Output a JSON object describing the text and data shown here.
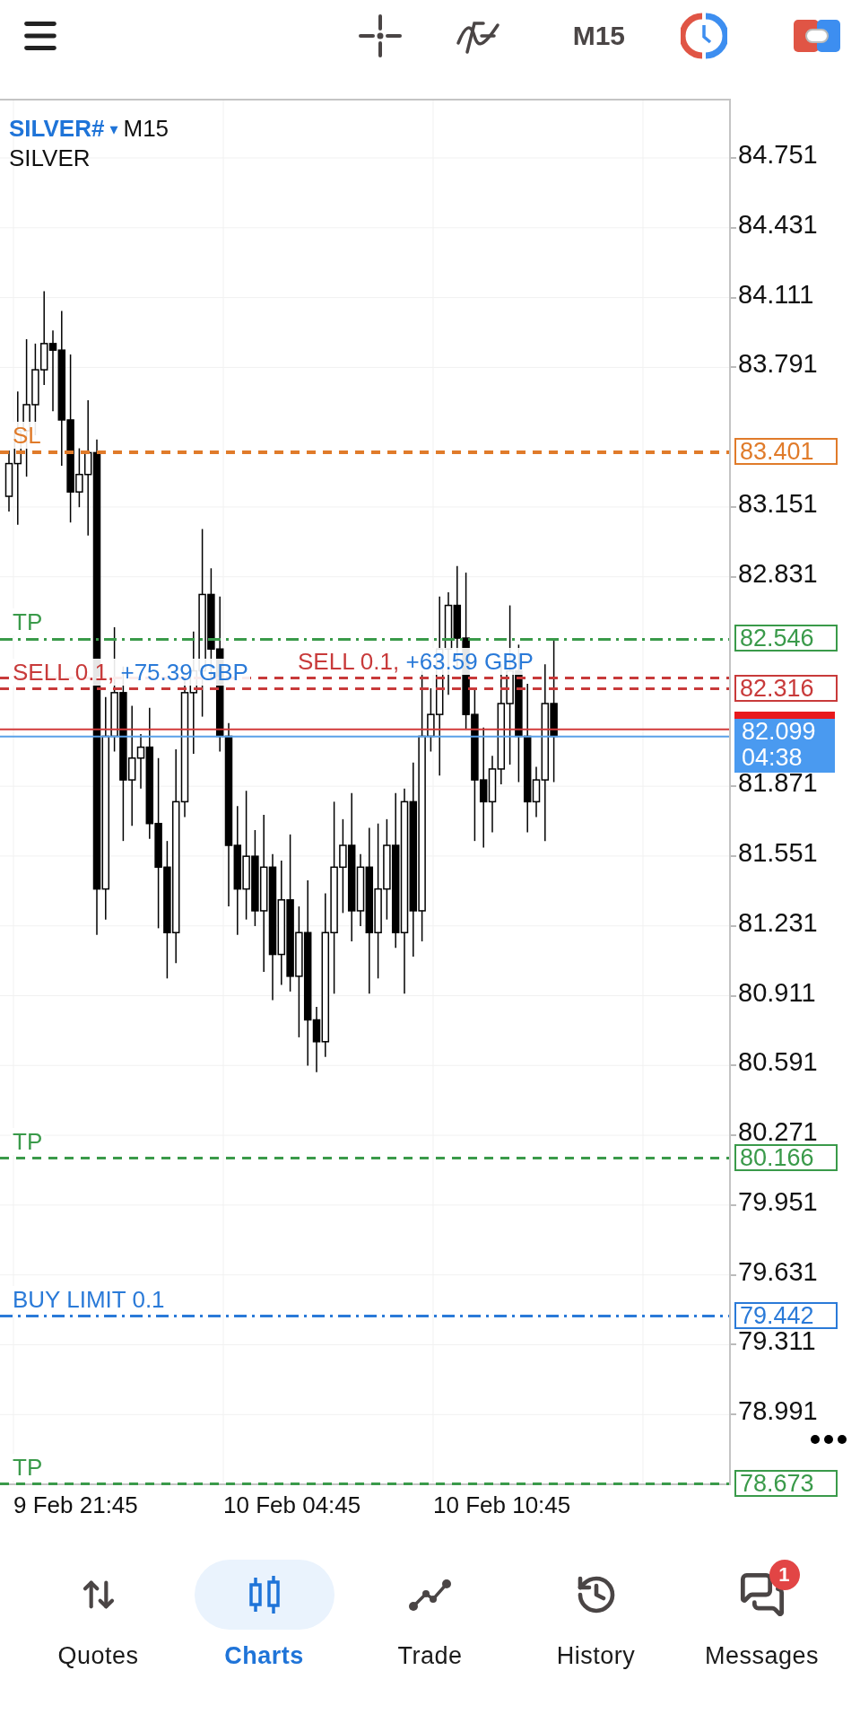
{
  "toolbar": {
    "timeframe": "M15"
  },
  "chart": {
    "symbol": "SILVER#",
    "caret": "▾",
    "timeframe": "M15",
    "description": "SILVER",
    "price_ticks": [
      "84.751",
      "84.431",
      "84.111",
      "83.791",
      "83.151",
      "82.831",
      "81.871",
      "81.551",
      "81.231",
      "80.911",
      "80.591",
      "80.271",
      "79.951",
      "79.631",
      "79.311",
      "78.991"
    ],
    "lines": [
      {
        "kind": "sl",
        "label": "SL",
        "price": "83.401",
        "dash_dot": false
      },
      {
        "kind": "tp",
        "label": "TP",
        "price": "82.546",
        "dash_dot": true
      },
      {
        "kind": "sell",
        "label": "SELL 0.1,",
        "profit": "+75.39 GBP",
        "price": "82.316",
        "dash_dot": false
      },
      {
        "kind": "sell",
        "label": "SELL 0.1,",
        "profit": "+63.59 GBP",
        "dash_dot": false
      },
      {
        "kind": "tp",
        "label": "TP",
        "price": "80.166",
        "dash_dot": false
      },
      {
        "kind": "buy_limit",
        "label": "BUY LIMIT 0.1",
        "price": "79.442",
        "dash_dot": true
      },
      {
        "kind": "tp",
        "label": "TP",
        "price": "78.673",
        "dash_dot": false
      }
    ],
    "current": {
      "price": "82.099",
      "countdown": "04:38",
      "ask_line": true
    },
    "time_labels": [
      "9 Feb 21:45",
      "10 Feb 04:45",
      "10 Feb 10:45"
    ]
  },
  "nav": [
    {
      "kind": "quotes",
      "label": "Quotes",
      "selected": false
    },
    {
      "kind": "charts",
      "label": "Charts",
      "selected": true
    },
    {
      "kind": "trade",
      "label": "Trade",
      "selected": false
    },
    {
      "kind": "history",
      "label": "History",
      "selected": false
    },
    {
      "kind": "messages",
      "label": "Messages",
      "selected": false,
      "badge": "1"
    }
  ]
}
